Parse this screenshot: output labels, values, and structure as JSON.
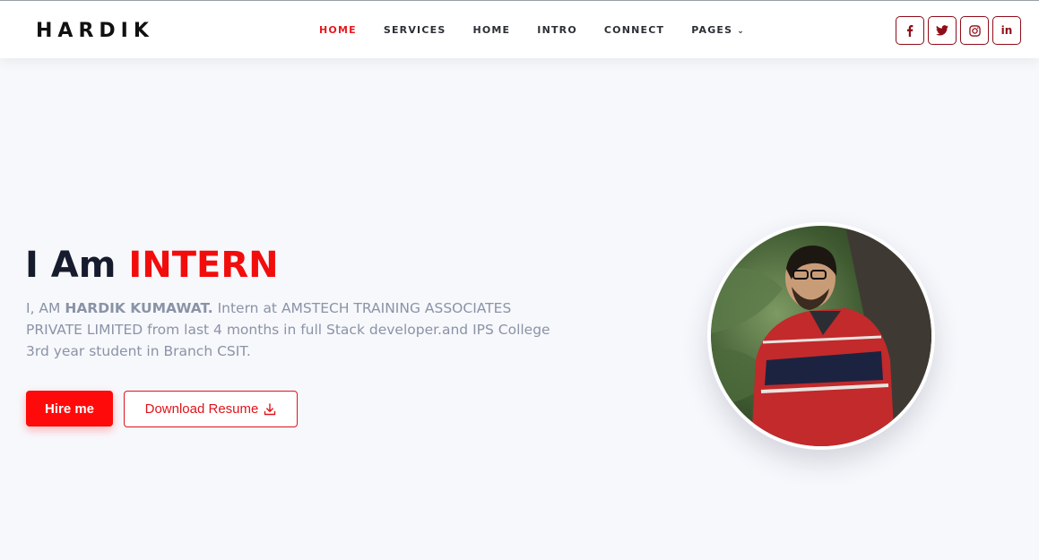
{
  "brand": {
    "logo": "HARDIK"
  },
  "nav": {
    "items": [
      {
        "label": "HOME",
        "active": true
      },
      {
        "label": "SERVICES",
        "active": false
      },
      {
        "label": "HOME",
        "active": false
      },
      {
        "label": "INTRO",
        "active": false
      },
      {
        "label": "CONNECT",
        "active": false
      },
      {
        "label": "PAGES",
        "active": false,
        "has_dropdown": true
      }
    ]
  },
  "socials": [
    {
      "icon": "facebook-icon"
    },
    {
      "icon": "twitter-icon"
    },
    {
      "icon": "instagram-icon"
    },
    {
      "icon": "linkedin-icon",
      "glyph": "in"
    }
  ],
  "hero": {
    "title_prefix": "I Am",
    "title_accent": "INTERN",
    "desc_lead": "I, AM",
    "desc_name": "HARDIK KUMAWAT.",
    "desc_rest": "Intern at AMSTECH TRAINING ASSOCIATES PRIVATE LIMITED from last 4 months in full Stack developer.and IPS College 3rd year student in Branch CSIT.",
    "hire_label": "Hire me",
    "resume_label": "Download Resume"
  },
  "colors": {
    "accent": "#f20d0d",
    "social_border": "#8f0d18",
    "background": "#f7f8fc"
  }
}
